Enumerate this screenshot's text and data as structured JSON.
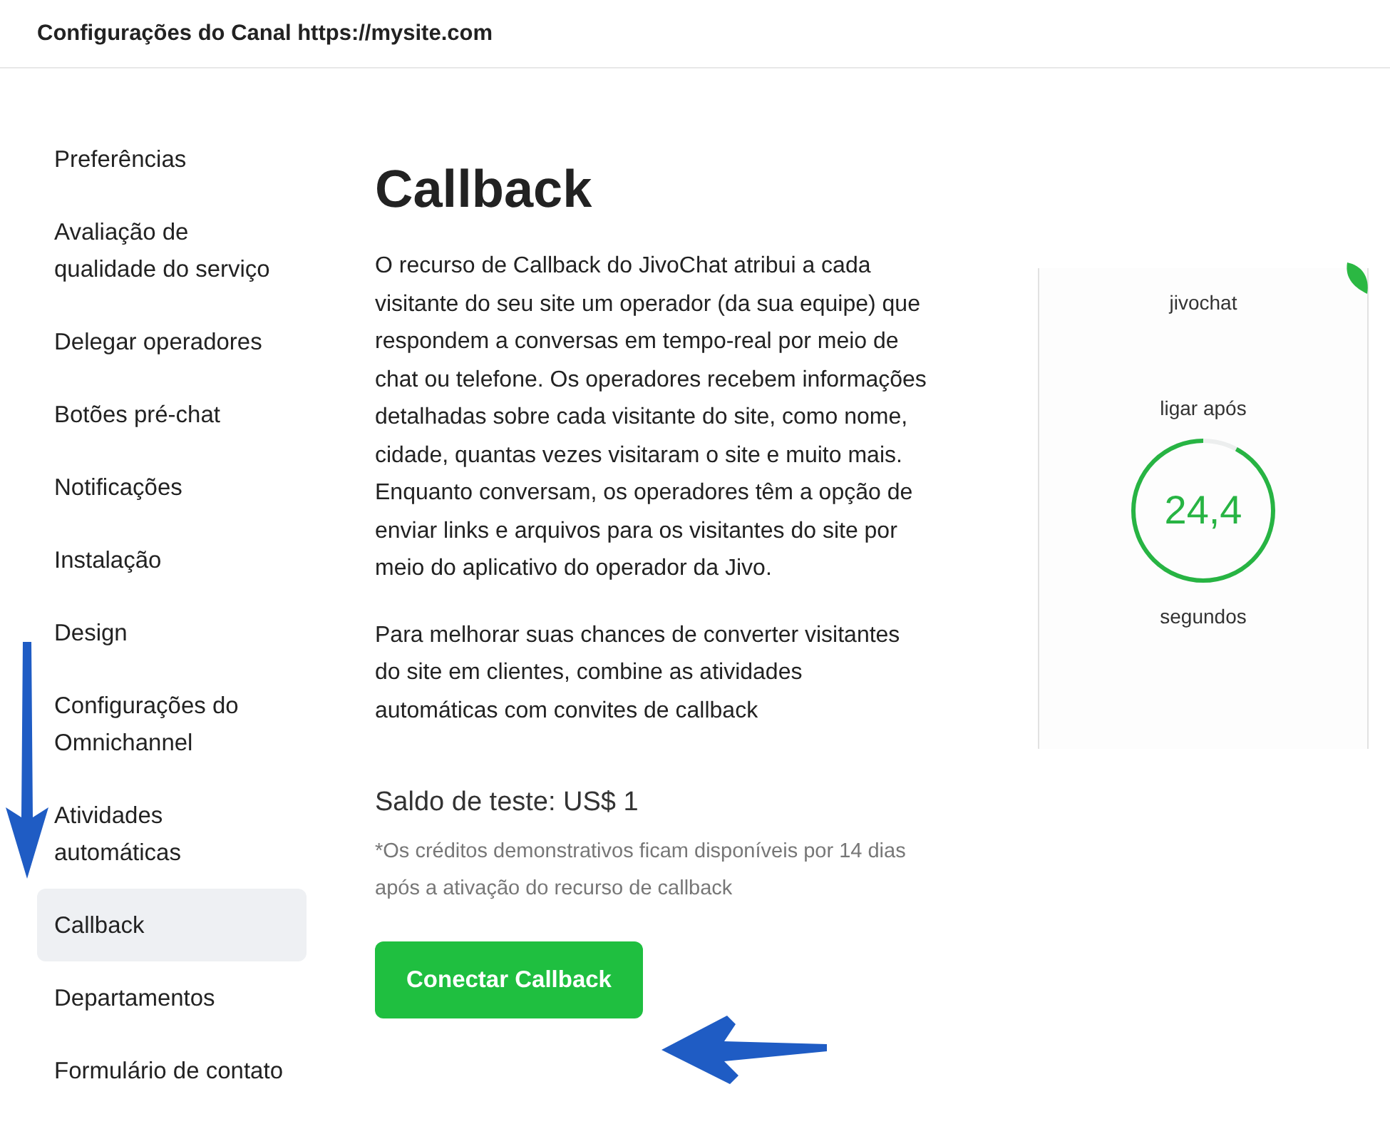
{
  "header": {
    "title": "Configurações do Canal https://mysite.com"
  },
  "sidebar": {
    "items": [
      {
        "label": "Preferências",
        "selected": false
      },
      {
        "label": "Avaliação de qualidade do serviço",
        "selected": false
      },
      {
        "label": "Delegar operadores",
        "selected": false
      },
      {
        "label": "Botões pré-chat",
        "selected": false
      },
      {
        "label": "Notificações",
        "selected": false
      },
      {
        "label": "Instalação",
        "selected": false
      },
      {
        "label": "Design",
        "selected": false
      },
      {
        "label": "Configurações do Omnichannel",
        "selected": false
      },
      {
        "label": "Atividades automáticas",
        "selected": false
      },
      {
        "label": "Callback",
        "selected": true
      },
      {
        "label": "Departamentos",
        "selected": false
      },
      {
        "label": "Formulário de contato",
        "selected": false
      }
    ]
  },
  "content": {
    "title": "Callback",
    "paragraphs": [
      "O recurso de Callback do JivoChat atribui a cada visitante do seu site um operador (da sua equipe) que respondem a conversas em tempo-real por meio de chat ou telefone. Os operadores recebem informações detalhadas sobre cada visitante do site, como nome, cidade, quantas vezes visitaram o site e muito mais. Enquanto conversam, os operadores têm a opção de enviar links e arquivos para os visitantes do site por meio do aplicativo do operador da Jivo.",
      "Para melhorar suas chances de converter visitantes do site em clientes, combine as atividades automáticas com convites de callback"
    ],
    "balance": "Saldo de teste: US$ 1",
    "note": "*Os créditos demonstrativos ficam disponíveis por 14 dias após a ativação do recurso de callback",
    "button": "Conectar Callback"
  },
  "preview": {
    "logo": "jivochat",
    "caption_top": "ligar após",
    "timer": "24,4",
    "level": 0.92,
    "caption_bottom": "segundos"
  }
}
